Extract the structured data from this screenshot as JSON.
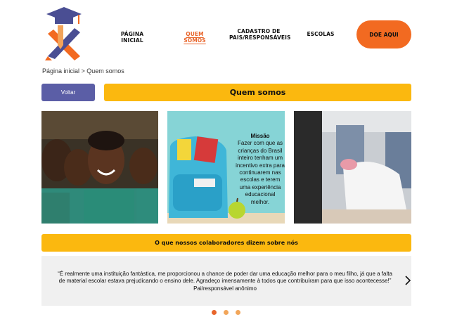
{
  "nav": {
    "home": "PÁGINA INICIAL",
    "about": "QUEM SOMOS",
    "register_line1": "CADASTRO DE",
    "register_line2": "PAIS/RESPONSÁVEIS",
    "schools": "ESCOLAS",
    "donate": "DOE AQUI"
  },
  "breadcrumb": "Página inicial > Quem somos",
  "back_button": "Voltar",
  "page_title": "Quem somos",
  "mission": {
    "title": "Missão",
    "text": "Fazer com que as crianças do Brasil inteiro tenham um incentivo extra para continuarem nas escolas e terem uma experiência educacional melhor."
  },
  "testimonials": {
    "heading": "O que nossos colaboradores dizem sobre nós",
    "quote_line1": "“É realmente uma instituição fantástica, me proporcionou a chance de poder dar uma educação melhor para o meu filho, já que a falta",
    "quote_line2": "de material escolar estava prejudicando o ensino dele. Agradeço imensamente à todos que contribuíram para que isso acontecesse!”",
    "author": "Pai/responsável anônimo",
    "active_slide": 1,
    "slide_count": 3
  },
  "icons": {
    "logo": "graduation-cap-pencil-logo",
    "next": "chevron-right-icon"
  },
  "colors": {
    "accent_orange": "#f26a21",
    "yellow": "#fbb80f",
    "purple": "#5b5ea6"
  }
}
